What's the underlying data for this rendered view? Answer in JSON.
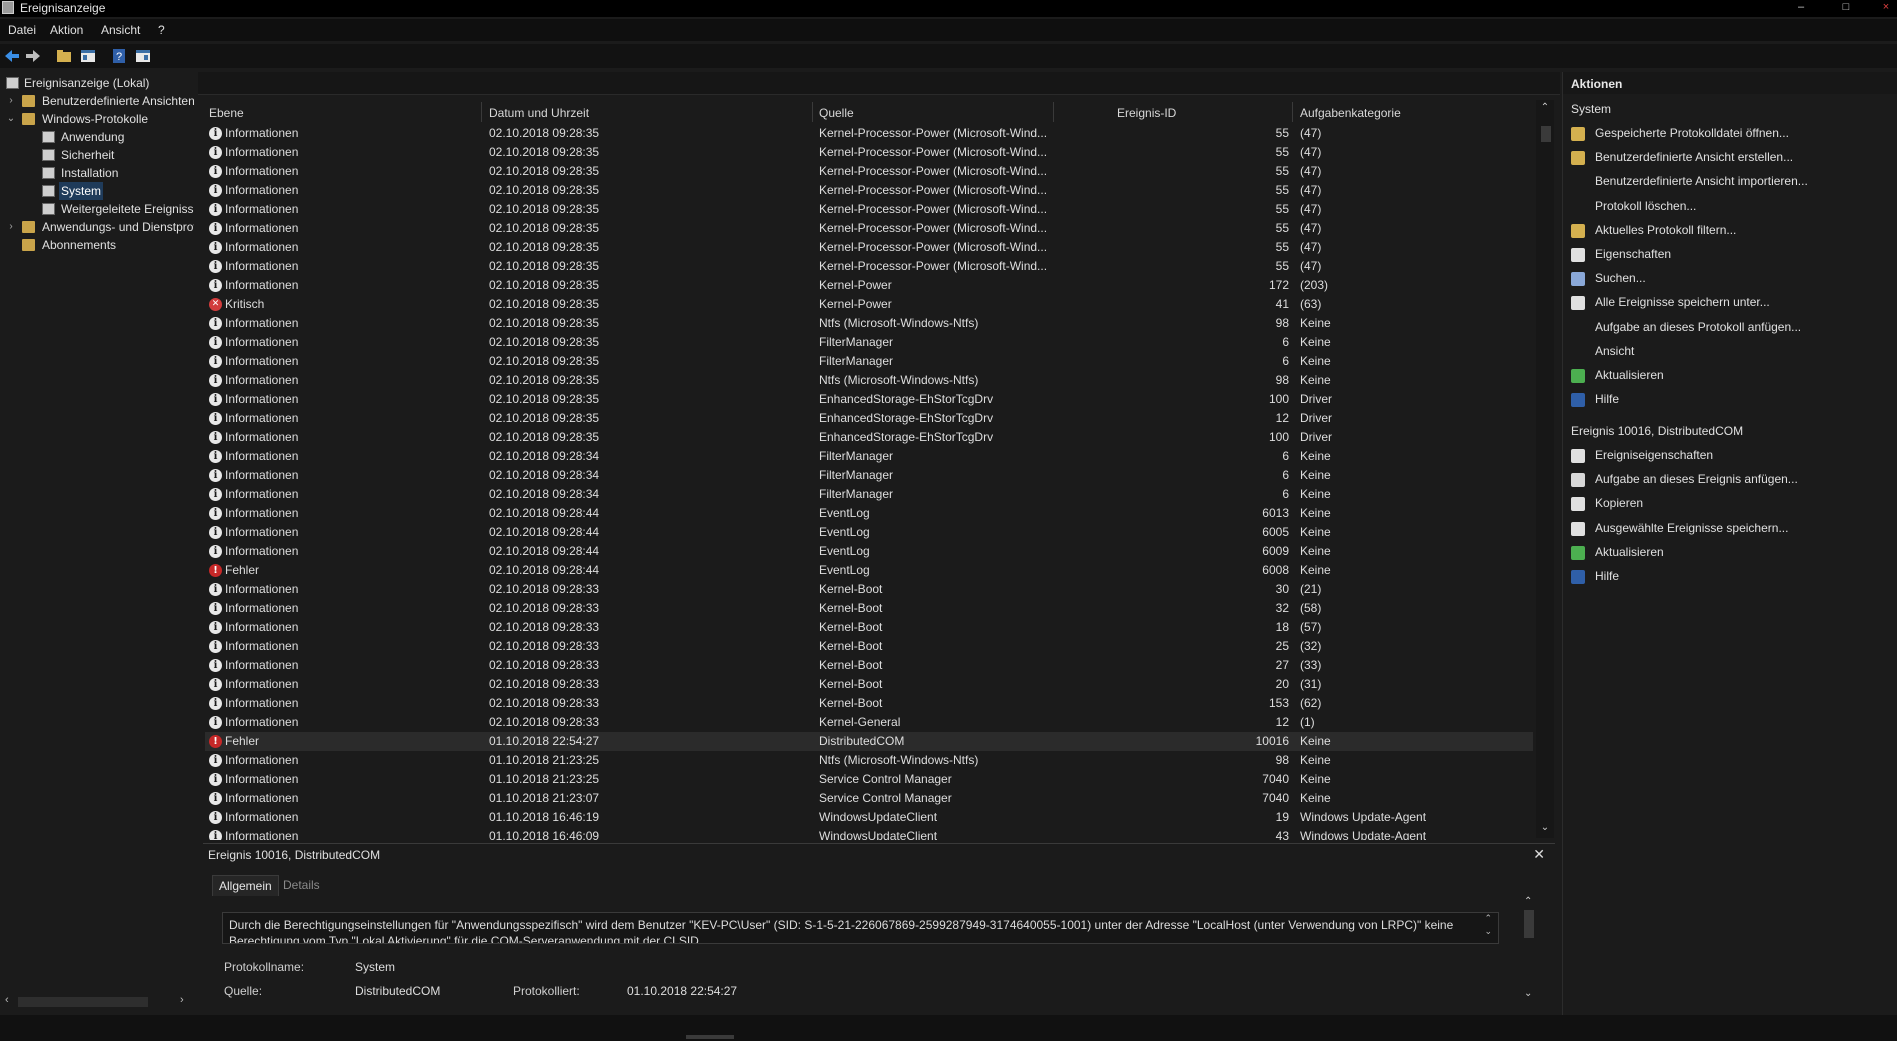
{
  "window": {
    "title": "Ereignisanzeige"
  },
  "menu": [
    "Datei",
    "Aktion",
    "Ansicht",
    "?"
  ],
  "tree": {
    "root": "Ereignisanzeige (Lokal)",
    "custom_views": "Benutzerdefinierte Ansichten",
    "windows_logs": "Windows-Protokolle",
    "app": "Anwendung",
    "security": "Sicherheit",
    "installation": "Installation",
    "system": "System",
    "forwarded": "Weitergeleitete Ereignisse",
    "app_services": "Anwendungs- und Dienstprotokolle",
    "subscriptions": "Abonnements"
  },
  "columns": {
    "level": "Ebene",
    "datetime": "Datum und Uhrzeit",
    "source": "Quelle",
    "event_id": "Ereignis-ID",
    "task": "Aufgabenkategorie"
  },
  "events": [
    [
      "info",
      "Informationen",
      "02.10.2018 09:28:35",
      "Kernel-Processor-Power (Microsoft-Wind...",
      "55",
      "(47)"
    ],
    [
      "info",
      "Informationen",
      "02.10.2018 09:28:35",
      "Kernel-Processor-Power (Microsoft-Wind...",
      "55",
      "(47)"
    ],
    [
      "info",
      "Informationen",
      "02.10.2018 09:28:35",
      "Kernel-Processor-Power (Microsoft-Wind...",
      "55",
      "(47)"
    ],
    [
      "info",
      "Informationen",
      "02.10.2018 09:28:35",
      "Kernel-Processor-Power (Microsoft-Wind...",
      "55",
      "(47)"
    ],
    [
      "info",
      "Informationen",
      "02.10.2018 09:28:35",
      "Kernel-Processor-Power (Microsoft-Wind...",
      "55",
      "(47)"
    ],
    [
      "info",
      "Informationen",
      "02.10.2018 09:28:35",
      "Kernel-Processor-Power (Microsoft-Wind...",
      "55",
      "(47)"
    ],
    [
      "info",
      "Informationen",
      "02.10.2018 09:28:35",
      "Kernel-Processor-Power (Microsoft-Wind...",
      "55",
      "(47)"
    ],
    [
      "info",
      "Informationen",
      "02.10.2018 09:28:35",
      "Kernel-Processor-Power (Microsoft-Wind...",
      "55",
      "(47)"
    ],
    [
      "info",
      "Informationen",
      "02.10.2018 09:28:35",
      "Kernel-Power",
      "172",
      "(203)"
    ],
    [
      "crit",
      "Kritisch",
      "02.10.2018 09:28:35",
      "Kernel-Power",
      "41",
      "(63)"
    ],
    [
      "info",
      "Informationen",
      "02.10.2018 09:28:35",
      "Ntfs (Microsoft-Windows-Ntfs)",
      "98",
      "Keine"
    ],
    [
      "info",
      "Informationen",
      "02.10.2018 09:28:35",
      "FilterManager",
      "6",
      "Keine"
    ],
    [
      "info",
      "Informationen",
      "02.10.2018 09:28:35",
      "FilterManager",
      "6",
      "Keine"
    ],
    [
      "info",
      "Informationen",
      "02.10.2018 09:28:35",
      "Ntfs (Microsoft-Windows-Ntfs)",
      "98",
      "Keine"
    ],
    [
      "info",
      "Informationen",
      "02.10.2018 09:28:35",
      "EnhancedStorage-EhStorTcgDrv",
      "100",
      "Driver"
    ],
    [
      "info",
      "Informationen",
      "02.10.2018 09:28:35",
      "EnhancedStorage-EhStorTcgDrv",
      "12",
      "Driver"
    ],
    [
      "info",
      "Informationen",
      "02.10.2018 09:28:35",
      "EnhancedStorage-EhStorTcgDrv",
      "100",
      "Driver"
    ],
    [
      "info",
      "Informationen",
      "02.10.2018 09:28:34",
      "FilterManager",
      "6",
      "Keine"
    ],
    [
      "info",
      "Informationen",
      "02.10.2018 09:28:34",
      "FilterManager",
      "6",
      "Keine"
    ],
    [
      "info",
      "Informationen",
      "02.10.2018 09:28:34",
      "FilterManager",
      "6",
      "Keine"
    ],
    [
      "info",
      "Informationen",
      "02.10.2018 09:28:44",
      "EventLog",
      "6013",
      "Keine"
    ],
    [
      "info",
      "Informationen",
      "02.10.2018 09:28:44",
      "EventLog",
      "6005",
      "Keine"
    ],
    [
      "info",
      "Informationen",
      "02.10.2018 09:28:44",
      "EventLog",
      "6009",
      "Keine"
    ],
    [
      "err",
      "Fehler",
      "02.10.2018 09:28:44",
      "EventLog",
      "6008",
      "Keine"
    ],
    [
      "info",
      "Informationen",
      "02.10.2018 09:28:33",
      "Kernel-Boot",
      "30",
      "(21)"
    ],
    [
      "info",
      "Informationen",
      "02.10.2018 09:28:33",
      "Kernel-Boot",
      "32",
      "(58)"
    ],
    [
      "info",
      "Informationen",
      "02.10.2018 09:28:33",
      "Kernel-Boot",
      "18",
      "(57)"
    ],
    [
      "info",
      "Informationen",
      "02.10.2018 09:28:33",
      "Kernel-Boot",
      "25",
      "(32)"
    ],
    [
      "info",
      "Informationen",
      "02.10.2018 09:28:33",
      "Kernel-Boot",
      "27",
      "(33)"
    ],
    [
      "info",
      "Informationen",
      "02.10.2018 09:28:33",
      "Kernel-Boot",
      "20",
      "(31)"
    ],
    [
      "info",
      "Informationen",
      "02.10.2018 09:28:33",
      "Kernel-Boot",
      "153",
      "(62)"
    ],
    [
      "info",
      "Informationen",
      "02.10.2018 09:28:33",
      "Kernel-General",
      "12",
      "(1)"
    ],
    [
      "err",
      "Fehler",
      "01.10.2018 22:54:27",
      "DistributedCOM",
      "10016",
      "Keine"
    ],
    [
      "info",
      "Informationen",
      "01.10.2018 21:23:25",
      "Ntfs (Microsoft-Windows-Ntfs)",
      "98",
      "Keine"
    ],
    [
      "info",
      "Informationen",
      "01.10.2018 21:23:25",
      "Service Control Manager",
      "7040",
      "Keine"
    ],
    [
      "info",
      "Informationen",
      "01.10.2018 21:23:07",
      "Service Control Manager",
      "7040",
      "Keine"
    ],
    [
      "info",
      "Informationen",
      "01.10.2018 16:46:19",
      "WindowsUpdateClient",
      "19",
      "Windows Update-Agent"
    ],
    [
      "info",
      "Informationen",
      "01.10.2018 16:46:09",
      "WindowsUpdateClient",
      "43",
      "Windows Update-Agent"
    ]
  ],
  "selected_index": 32,
  "detail": {
    "title": "Ereignis 10016, DistributedCOM",
    "tab_general": "Allgemein",
    "tab_details": "Details",
    "description": "Durch die Berechtigungseinstellungen für \"Anwendungsspezifisch\" wird dem Benutzer \"KEV-PC\\User\" (SID: S-1-5-21-226067869-2599287949-3174640055-1001) unter der Adresse \"LocalHost (unter Verwendung von LRPC)\" keine Berechtigung vom Typ \"Lokal Aktivierung\" für die COM-Serveranwendung mit der CLSID",
    "log_name_label": "Protokollname:",
    "log_name": "System",
    "source_label": "Quelle:",
    "source": "DistributedCOM",
    "logged_label": "Protokolliert:",
    "logged": "01.10.2018 22:54:27"
  },
  "actions": {
    "header": "Aktionen",
    "section1": "System",
    "items1": [
      [
        "open",
        "Gespeicherte Protokolldatei öffnen..."
      ],
      [
        "filter",
        "Benutzerdefinierte Ansicht erstellen..."
      ],
      [
        "",
        "Benutzerdefinierte Ansicht importieren..."
      ],
      [
        "",
        "Protokoll löschen..."
      ],
      [
        "filter",
        "Aktuelles Protokoll filtern..."
      ],
      [
        "props",
        "Eigenschaften"
      ],
      [
        "find",
        "Suchen..."
      ],
      [
        "save",
        "Alle Ereignisse speichern unter..."
      ],
      [
        "",
        "Aufgabe an dieses Protokoll anfügen..."
      ],
      [
        "",
        "Ansicht"
      ],
      [
        "refresh",
        "Aktualisieren"
      ],
      [
        "help",
        "Hilfe"
      ]
    ],
    "section2": "Ereignis 10016, DistributedCOM",
    "items2": [
      [
        "props",
        "Ereigniseigenschaften"
      ],
      [
        "task",
        "Aufgabe an dieses Ereignis anfügen..."
      ],
      [
        "copy",
        "Kopieren"
      ],
      [
        "save",
        "Ausgewählte Ereignisse speichern..."
      ],
      [
        "refresh",
        "Aktualisieren"
      ],
      [
        "help",
        "Hilfe"
      ]
    ]
  },
  "colors": {
    "info": "#e8e8e8",
    "error": "#c62828",
    "selection": "#1f3b5a"
  },
  "window_controls": {
    "minimize": "–",
    "maximize": "□",
    "close": "×"
  }
}
